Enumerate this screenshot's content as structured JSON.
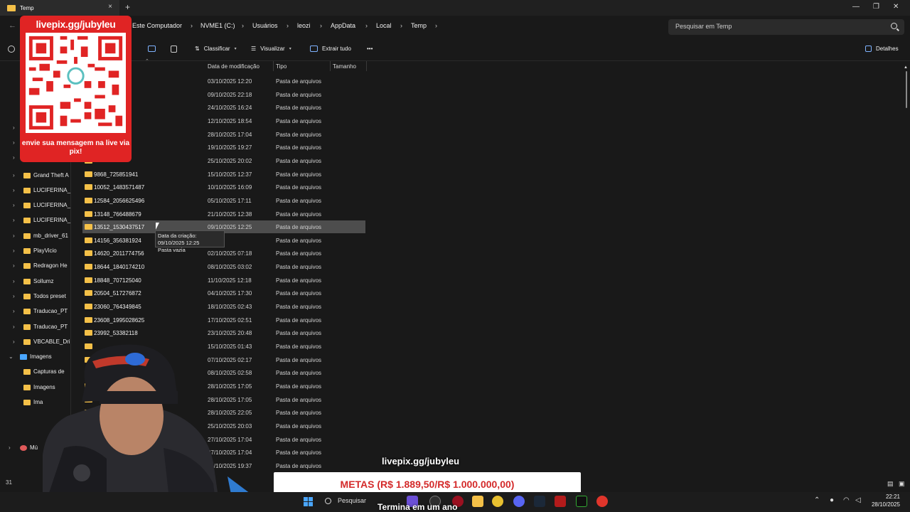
{
  "window": {
    "tab_title": "Temp",
    "tab_close": "×",
    "tab_add": "+"
  },
  "address": {
    "crumbs": [
      "Este Computador",
      "NVME1 (C:)",
      "Usuários",
      "leozi",
      "AppData",
      "Local",
      "Temp"
    ],
    "search_placeholder": "Pesquisar em Temp"
  },
  "toolbar": {
    "sort_label": "Classificar",
    "view_label": "Visualizar",
    "extract_label": "Extrair tudo",
    "more_label": "•••",
    "details_label": "Detalhes"
  },
  "columns": {
    "date": "Data de modificação",
    "type": "Tipo",
    "size": "Tamanho"
  },
  "sidebar": {
    "items": [
      {
        "label": "Grand Theft A",
        "chev": "›"
      },
      {
        "label": "LUCIFERINA_",
        "chev": "›"
      },
      {
        "label": "LUCIFERINA_",
        "chev": "›"
      },
      {
        "label": "LUCIFERINA_",
        "chev": "›"
      },
      {
        "label": "mb_driver_61",
        "chev": "›"
      },
      {
        "label": "PlayVicio",
        "chev": "›"
      },
      {
        "label": "Redragon He",
        "chev": "›"
      },
      {
        "label": "Sollumz",
        "chev": "›"
      },
      {
        "label": "Todos preset",
        "chev": "›"
      },
      {
        "label": "Traducao_PT",
        "chev": "›"
      },
      {
        "label": "Traducao_PT",
        "chev": "›"
      },
      {
        "label": "VBCABLE_Dri",
        "chev": "›"
      }
    ],
    "images_label": "Imagens",
    "images_children": [
      "Capturas de",
      "Imagens",
      "Ima"
    ],
    "music_label": "Mú"
  },
  "files": [
    {
      "name": "",
      "date": "03/10/2025 12:20",
      "type": "Pasta de arquivos"
    },
    {
      "name": "",
      "date": "09/10/2025 22:18",
      "type": "Pasta de arquivos"
    },
    {
      "name": "",
      "date": "24/10/2025 16:24",
      "type": "Pasta de arquivos"
    },
    {
      "name": "",
      "date": "12/10/2025 18:54",
      "type": "Pasta de arquivos"
    },
    {
      "name": "",
      "date": "28/10/2025 17:04",
      "type": "Pasta de arquivos"
    },
    {
      "name": "",
      "date": "19/10/2025 19:27",
      "type": "Pasta de arquivos"
    },
    {
      "name": "",
      "date": "25/10/2025 20:02",
      "type": "Pasta de arquivos"
    },
    {
      "name": "9868_725851941",
      "date": "15/10/2025 12:37",
      "type": "Pasta de arquivos"
    },
    {
      "name": "10052_1483571487",
      "date": "10/10/2025 16:09",
      "type": "Pasta de arquivos"
    },
    {
      "name": "12584_2056625496",
      "date": "05/10/2025 17:11",
      "type": "Pasta de arquivos"
    },
    {
      "name": "13148_766488679",
      "date": "21/10/2025 12:38",
      "type": "Pasta de arquivos"
    },
    {
      "name": "13512_1530437517",
      "date": "09/10/2025 12:25",
      "type": "Pasta de arquivos"
    },
    {
      "name": "14156_356381924",
      "date": "",
      "type": "Pasta de arquivos"
    },
    {
      "name": "14620_2011774756",
      "date": "02/10/2025 07:18",
      "type": "Pasta de arquivos"
    },
    {
      "name": "18644_1840174210",
      "date": "08/10/2025 03:02",
      "type": "Pasta de arquivos"
    },
    {
      "name": "18848_707125040",
      "date": "11/10/2025 12:18",
      "type": "Pasta de arquivos"
    },
    {
      "name": "20504_517276872",
      "date": "04/10/2025 17:30",
      "type": "Pasta de arquivos"
    },
    {
      "name": "23060_764349845",
      "date": "18/10/2025 02:43",
      "type": "Pasta de arquivos"
    },
    {
      "name": "23608_1995028625",
      "date": "17/10/2025 02:51",
      "type": "Pasta de arquivos"
    },
    {
      "name": "23992_53382118",
      "date": "23/10/2025 20:48",
      "type": "Pasta de arquivos"
    },
    {
      "name": "",
      "date": "15/10/2025 01:43",
      "type": "Pasta de arquivos"
    },
    {
      "name": "",
      "date": "07/10/2025 02:17",
      "type": "Pasta de arquivos"
    },
    {
      "name": "",
      "date": "08/10/2025 02:58",
      "type": "Pasta de arquivos"
    },
    {
      "name": "",
      "date": "28/10/2025 17:05",
      "type": "Pasta de arquivos"
    },
    {
      "name": "",
      "date": "28/10/2025 17:05",
      "type": "Pasta de arquivos"
    },
    {
      "name": "",
      "date": "28/10/2025 22:05",
      "type": "Pasta de arquivos"
    },
    {
      "name": "",
      "date": "25/10/2025 20:03",
      "type": "Pasta de arquivos"
    },
    {
      "name": "",
      "date": "27/10/2025 17:04",
      "type": "Pasta de arquivos"
    },
    {
      "name": "",
      "date": "27/10/2025 17:04",
      "type": "Pasta de arquivos"
    },
    {
      "name": "",
      "date": "28/10/2025 19:37",
      "type": "Pasta de arquivos"
    }
  ],
  "tooltip": {
    "line1": "Data da criação: 09/10/2025 12:25",
    "line2": "Pasta vazia"
  },
  "overlay": {
    "qr_header": "livepix.gg/jubyleu",
    "qr_footer": "envie sua mensagem na live via pix!",
    "live_link": "livepix.gg/jubyleu",
    "metas": "METAS (R$ 1.889,50/R$ 1.000.000,00)",
    "subtitle": "Termina em um ano"
  },
  "taskbar": {
    "search_label": "Pesquisar",
    "time": "22:21",
    "date": "28/10/2025",
    "left_number": "31"
  },
  "colors": {
    "folder": "#f4c048",
    "accent": "#4aa6ff",
    "qr_red": "#e02424",
    "metas_red": "#d42a2a"
  }
}
